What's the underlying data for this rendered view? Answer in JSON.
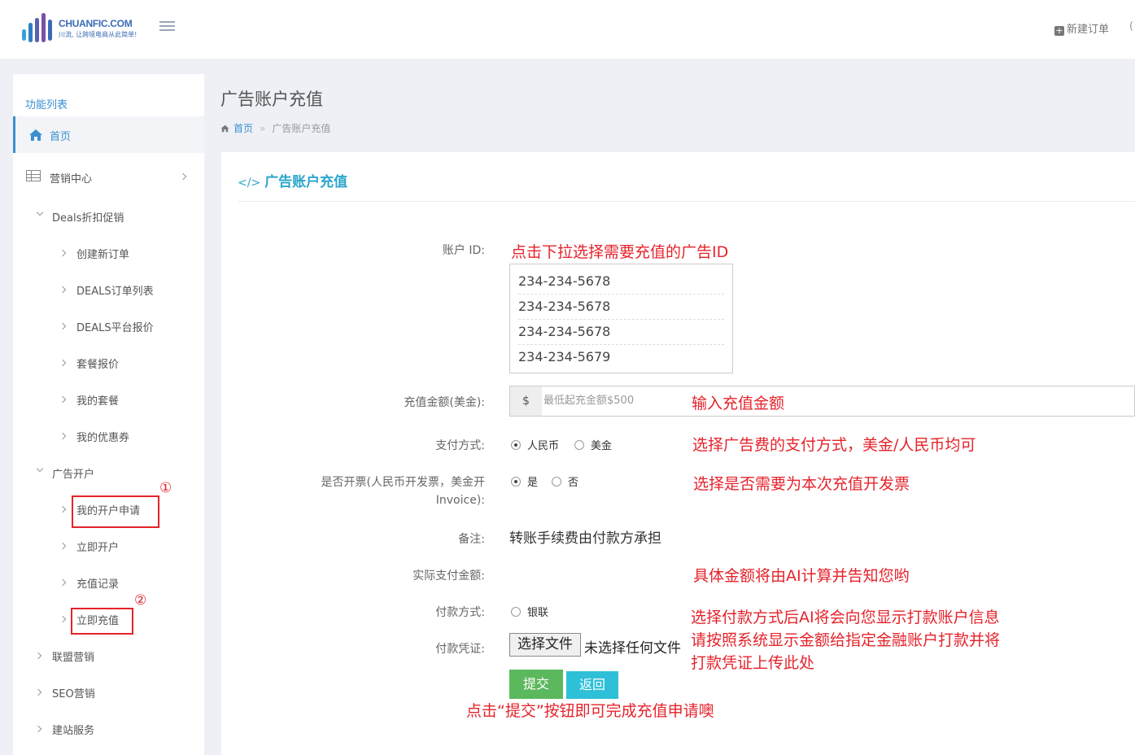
{
  "header": {
    "brand": "CHUANFIC.COM",
    "slogan": "川流, 让跨境电商从此简单!",
    "new_order": "新建订单"
  },
  "sidebar": {
    "title": "功能列表",
    "home": "首页",
    "marketing": "营销中心",
    "deals": "Deals折扣促销",
    "deals_items": [
      "创建新订单",
      "DEALS订单列表",
      "DEALS平台报价",
      "套餐报价",
      "我的套餐",
      "我的优惠券"
    ],
    "ad": "广告开户",
    "ad_items": [
      "我的开户申请",
      "立即开户",
      "充值记录",
      "立即充值"
    ],
    "others": [
      "联盟营销",
      "SEO营销",
      "建站服务"
    ]
  },
  "annotation_marks": [
    "①",
    "②"
  ],
  "page": {
    "title": "广告账户充值",
    "breadcrumb_home": "首页",
    "breadcrumb_current": "广告账户充值",
    "breadcrumb_sep": "»"
  },
  "panel": {
    "title": "广告账户充值",
    "code_icon": "</>"
  },
  "form": {
    "account_label": "账户 ID:",
    "account_ids": [
      "234-234-5678",
      "234-234-5678",
      "234-234-5678",
      "234-234-5679"
    ],
    "amount_label": "充值金额(美金):",
    "currency_symbol": "$",
    "amount_placeholder": "最低起充金额$500",
    "pay_method_label": "支付方式:",
    "pay_options": [
      "人民币",
      "美金"
    ],
    "invoice_label_1": "是否开票(人民币开发票，美金开",
    "invoice_label_2": "Invoice):",
    "invoice_options": [
      "是",
      "否"
    ],
    "remark_label": "备注:",
    "remark_value": "转账手续费由付款方承担",
    "actual_label": "实际支付金额:",
    "payment_label": "付款方式:",
    "payment_option": "银联",
    "voucher_label": "付款凭证:",
    "file_button": "选择文件",
    "file_text": "未选择任何文件",
    "submit": "提交",
    "back": "返回"
  },
  "annotations": {
    "account": "点击下拉选择需要充值的广告ID",
    "amount": "输入充值金额",
    "pay_method": "选择广告费的支付方式，美金/人民币均可",
    "invoice": "选择是否需要为本次充值开发票",
    "actual": "具体金额将由AI计算并告知您哟",
    "payment_1": "选择付款方式后AI将会向您显示打款账户信息",
    "payment_2": "请按照系统显示金额给指定金融账户打款并将",
    "payment_3": "打款凭证上传此处",
    "submit": "点击“提交”按钮即可完成充值申请噢"
  },
  "colors": {
    "accent": "#3b8fd0",
    "title_teal": "#2ba6cb",
    "annotation_red": "#e5232b",
    "submit_green": "#5cb85c",
    "back_cyan": "#2ec0d8"
  }
}
